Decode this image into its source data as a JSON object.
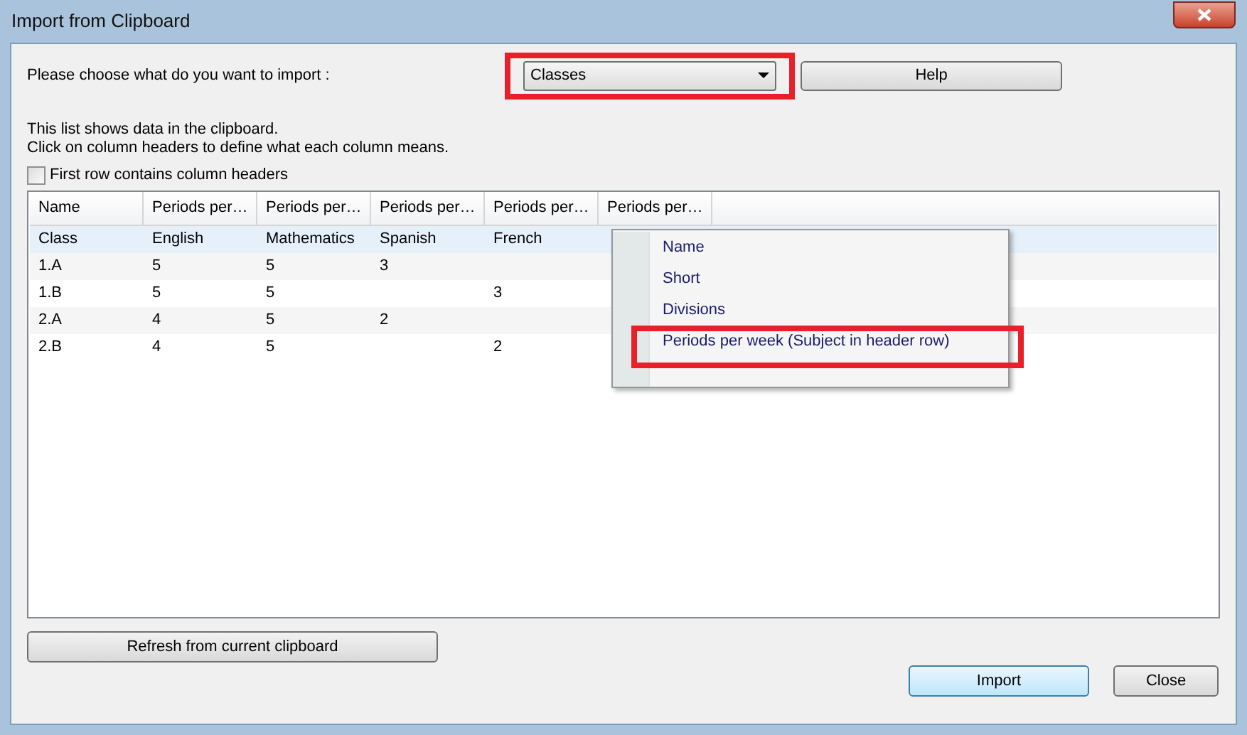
{
  "window": {
    "title": "Import from Clipboard"
  },
  "prompt": "Please choose what do you want to import :",
  "import_type": {
    "value": "Classes",
    "highlighted": true
  },
  "help_button": "Help",
  "info_lines": [
    "This list shows data in the clipboard.",
    "Click on column headers to define what each column means."
  ],
  "first_row_headers": {
    "label": "First row contains column headers",
    "checked": false
  },
  "table": {
    "columns": [
      "Name",
      "Periods per…",
      "Periods per…",
      "Periods per…",
      "Periods per…",
      "Periods per…"
    ],
    "rows": [
      {
        "selected": true,
        "cells": [
          "Class",
          "English",
          "Mathematics",
          "Spanish",
          "French"
        ]
      },
      {
        "selected": false,
        "cells": [
          "1.A",
          "5",
          "5",
          "3",
          ""
        ]
      },
      {
        "selected": false,
        "cells": [
          "1.B",
          "5",
          "5",
          "",
          "3"
        ]
      },
      {
        "selected": false,
        "cells": [
          "2.A",
          "4",
          "5",
          "2",
          ""
        ]
      },
      {
        "selected": false,
        "cells": [
          "2.B",
          "4",
          "5",
          "",
          "2"
        ]
      }
    ]
  },
  "context_menu": [
    {
      "label": "Name",
      "highlighted": false
    },
    {
      "label": "Short",
      "highlighted": false
    },
    {
      "label": "Divisions",
      "highlighted": false
    },
    {
      "label": "Periods per week (Subject in header row)",
      "highlighted": true
    }
  ],
  "refresh_button": "Refresh from current clipboard",
  "buttons": [
    {
      "label": "Import",
      "default": true
    },
    {
      "label": "Close",
      "default": false
    }
  ]
}
